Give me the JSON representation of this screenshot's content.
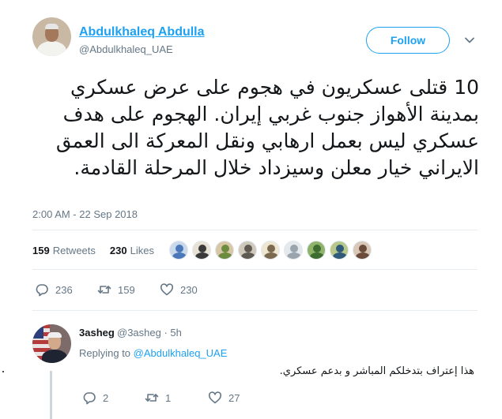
{
  "author": {
    "display_name": "Abdulkhaleq Abdulla",
    "screen_name": "@Abdulkhaleq_UAE"
  },
  "follow_label": "Follow",
  "tweet": {
    "text": "10 قتلى عسكريون في هجوم على عرض عسكري بمدينة الأهواز جنوب غربي إيران. الهجوم على هدف عسكري ليس بعمل ارهابي ونقل المعركة الى العمق الايراني خيار معلن وسيزداد خلال المرحلة القادمة.",
    "timestamp": "2:00 AM - 22 Sep 2018",
    "retweets_count": "159",
    "retweets_label": "Retweets",
    "likes_count": "230",
    "likes_label": "Likes"
  },
  "likers": [
    {
      "color": "#4a78b8",
      "bg": "#c9d8ea"
    },
    {
      "color": "#3a3a3a",
      "bg": "#e8e2d6"
    },
    {
      "color": "#6c8b3e",
      "bg": "#d8c7a6"
    },
    {
      "color": "#5e5a52",
      "bg": "#cfc9bc"
    },
    {
      "color": "#7b6a4f",
      "bg": "#efe6d2"
    },
    {
      "color": "#9aa4ad",
      "bg": "#e4e9ee"
    },
    {
      "color": "#3d6e2f",
      "bg": "#8fb36a"
    },
    {
      "color": "#2f5a7a",
      "bg": "#b7c88a"
    },
    {
      "color": "#6b4b3a",
      "bg": "#d9c8b8"
    }
  ],
  "actions": {
    "reply_count": "236",
    "retweet_count": "159",
    "like_count": "230"
  },
  "reply": {
    "name": "3asheg",
    "handle": "@3asheg · 5h",
    "replying_to_label": "Replying to",
    "replying_to_mention": "@Abdulkhaleq_UAE",
    "text": "هذا إعتراف بتدخلكم المباشر و بدعم عسكري.",
    "reply_count": "2",
    "retweet_count": "1",
    "like_count": "27"
  },
  "colors": {
    "accent": "#1da1f2",
    "secondary_text": "#657786",
    "border": "#e6ecf0"
  }
}
